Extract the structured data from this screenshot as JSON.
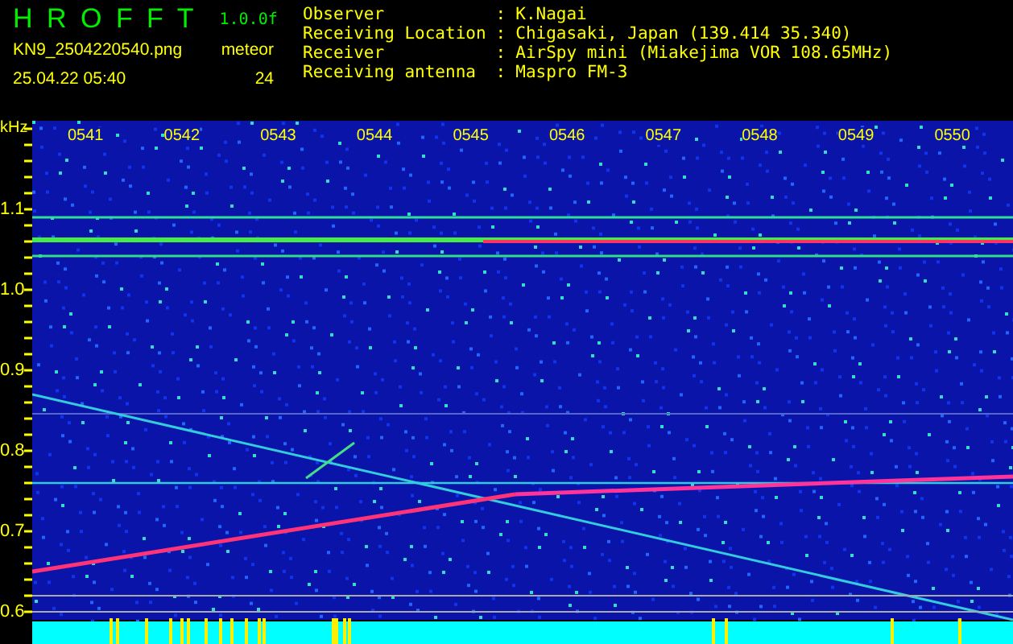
{
  "header": {
    "title": "H R O F F T",
    "version": "1.0.0f",
    "filename": "KN9_2504220540.png",
    "datetime": "25.04.22 05:40",
    "count_label": "meteor",
    "count": "24",
    "info": [
      {
        "label": "Observer",
        "sep": ":",
        "value": "K.Nagai"
      },
      {
        "label": "Receiving Location",
        "sep": ":",
        "value": "Chigasaki, Japan (139.414 35.340)"
      },
      {
        "label": "Receiver",
        "sep": ":",
        "value": "AirSpy mini (Miakejima VOR 108.65MHz)"
      },
      {
        "label": "Receiving antenna",
        "sep": ":",
        "value": "Maspro FM-3"
      }
    ]
  },
  "spectrogram": {
    "unit": "kHz",
    "y_labels": [
      "1.1",
      "1.0",
      "0.9",
      "0.8",
      "0.7",
      "0.6"
    ],
    "time_labels": [
      "0541",
      "0542",
      "0543",
      "0544",
      "0545",
      "0546",
      "0547",
      "0548",
      "0549",
      "0550"
    ]
  }
}
